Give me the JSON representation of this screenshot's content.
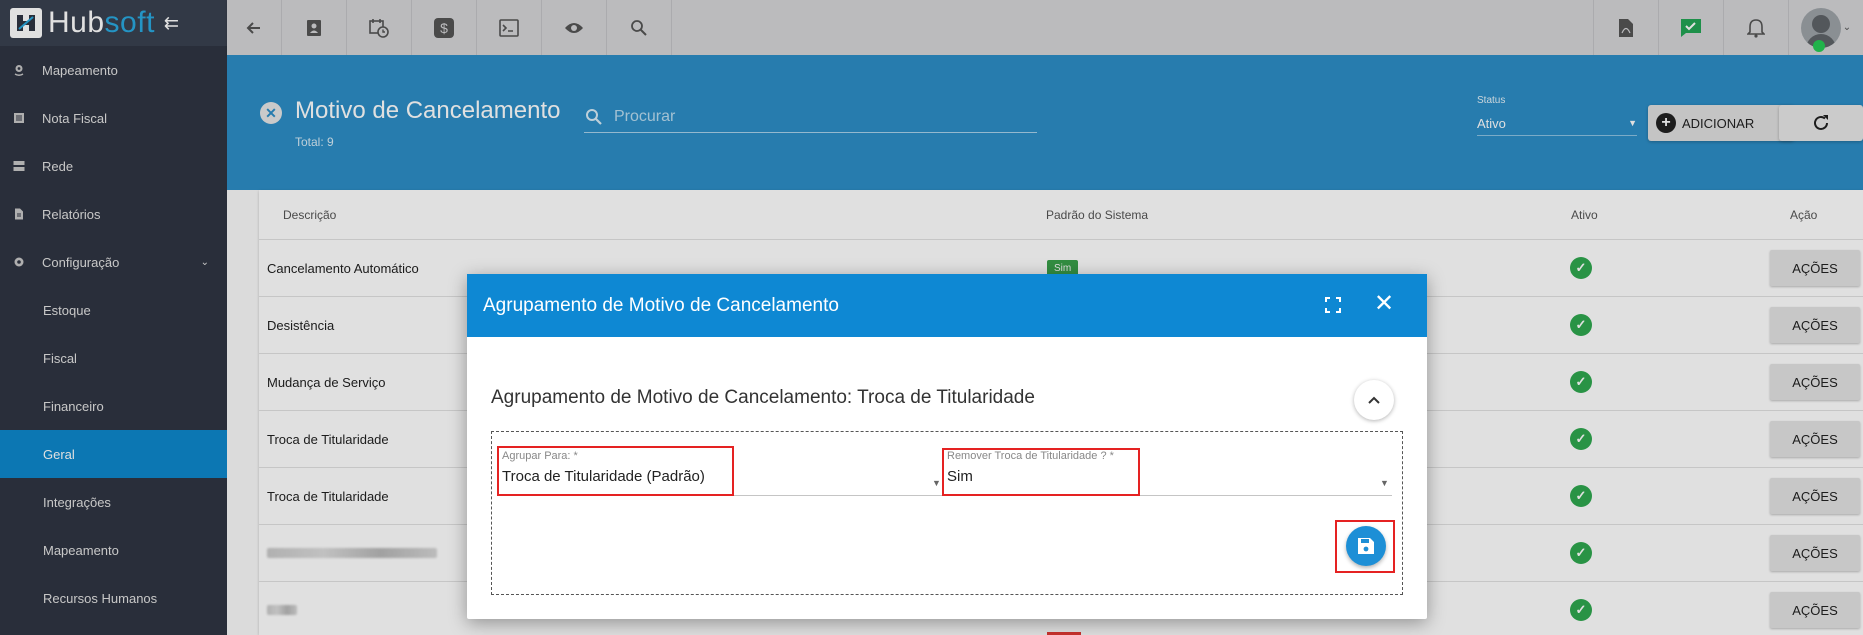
{
  "brand": {
    "name_part1": "Hub",
    "name_part2": "soft"
  },
  "sidebar": {
    "items": [
      {
        "label": "Mapeamento",
        "icon": "map-pin-icon"
      },
      {
        "label": "Nota Fiscal",
        "icon": "receipt-icon"
      },
      {
        "label": "Rede",
        "icon": "network-icon"
      },
      {
        "label": "Relatórios",
        "icon": "report-icon"
      },
      {
        "label": "Configuração",
        "icon": "gear-icon"
      },
      {
        "label": "Estoque"
      },
      {
        "label": "Fiscal"
      },
      {
        "label": "Financeiro"
      },
      {
        "label": "Geral"
      },
      {
        "label": "Integrações"
      },
      {
        "label": "Mapeamento"
      },
      {
        "label": "Recursos Humanos"
      }
    ]
  },
  "page": {
    "title": "Motivo de Cancelamento",
    "total": "Total: 9",
    "search_placeholder": "Procurar",
    "status_label": "Status",
    "status_value": "Ativo",
    "add_label": "ADICIONAR"
  },
  "table": {
    "headers": [
      "Descrição",
      "Padrão do Sistema",
      "Ativo",
      "Ação"
    ],
    "rows": [
      {
        "desc": "Cancelamento Automático",
        "padrao": "Sim",
        "acao": "AÇÕES"
      },
      {
        "desc": "Desistência",
        "padrao": "",
        "acao": "AÇÕES"
      },
      {
        "desc": "Mudança de Serviço",
        "padrao": "",
        "acao": "AÇÕES"
      },
      {
        "desc": "Troca de Titularidade",
        "padrao": "",
        "acao": "AÇÕES"
      },
      {
        "desc": "Troca de Titularidade",
        "padrao": "",
        "acao": "AÇÕES"
      },
      {
        "desc": "",
        "padrao": "",
        "acao": "AÇÕES"
      },
      {
        "desc": "",
        "padrao": "",
        "acao": "AÇÕES"
      }
    ]
  },
  "modal": {
    "title": "Agrupamento de Motivo de Cancelamento",
    "subtitle": "Agrupamento de Motivo de Cancelamento: Troca de Titularidade",
    "field1_label": "Agrupar Para: *",
    "field1_value": "Troca de Titularidade (Padrão)",
    "field2_label": "Remover Troca de Titularidade ? *",
    "field2_value": "Sim"
  },
  "colors": {
    "sidebar_bg": "#2f3542",
    "accent_blue": "#0e88d3",
    "active_green": "#2fa84f",
    "highlight_red": "#e52222"
  }
}
